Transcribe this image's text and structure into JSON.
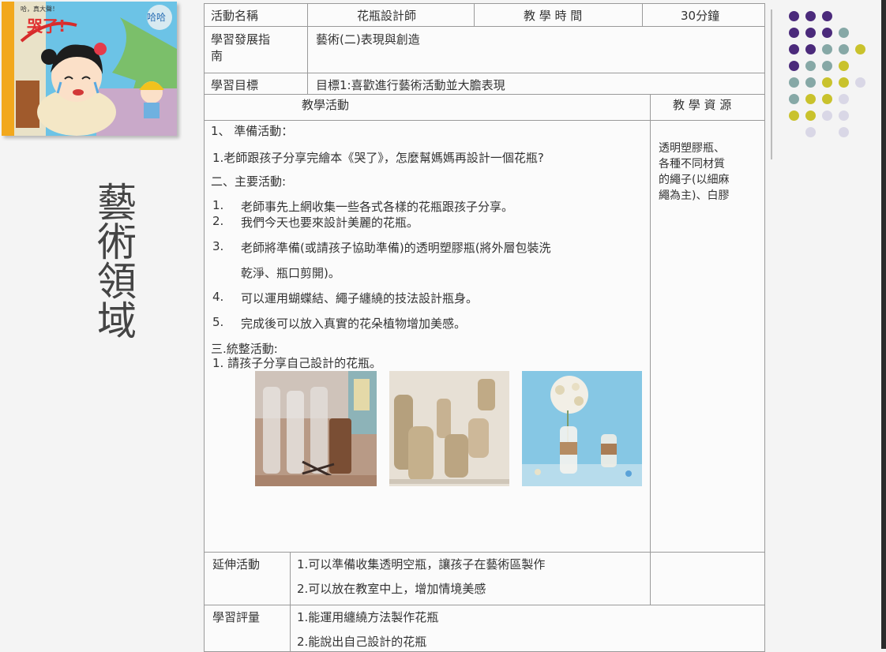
{
  "side_title": "藝術領域",
  "book": {
    "top_label": "哈，真大聲！",
    "title": "哭了!",
    "corner_mark": "哈哈"
  },
  "header": {
    "activity_name_label": "活動名稱",
    "activity_name_value": "花瓶設計師",
    "time_label": "教 學 時 間",
    "time_value": "30分鐘",
    "guide_label_line1": "學習發展指",
    "guide_label_line2": "南",
    "guide_value": "藝術(二)表現與創造",
    "goal_label": "學習目標",
    "goal_value": "目標1:喜歡進行藝術活動並大膽表現"
  },
  "activity": {
    "header": "教學活動",
    "resource_header": "教 學 資 源",
    "prep_title": "1、  準備活動：",
    "prep_item": "1.老師跟孩子分享完繪本《哭了》，怎麼幫媽媽再設計一個花瓶?",
    "main_title": "二、主要活動:",
    "main_items": [
      {
        "num": "1.",
        "text": "老師事先上網收集一些各式各樣的花瓶跟孩子分享。"
      },
      {
        "num": "2.",
        "text": "我們今天也要來設計美麗的花瓶。"
      },
      {
        "num": "3.",
        "text": "老師將準備(或請孩子協助準備)的透明塑膠瓶(將外層包裝洗"
      },
      {
        "num": "",
        "text": "乾淨、瓶口剪開)。"
      },
      {
        "num": "4.",
        "text": "可以運用蝴蝶結、繩子纏繞的技法設計瓶身。"
      },
      {
        "num": "5.",
        "text": "完成後可以放入真實的花朵植物增加美感。"
      }
    ],
    "wrap_title": "三.統整活動:",
    "wrap_item": "1. 請孩子分享自己設計的花瓶。",
    "resources": [
      "透明塑膠瓶、",
      "各種不同材質",
      "的繩子(以細麻",
      "繩為主)、白膠"
    ]
  },
  "extension": {
    "label": "延伸活動",
    "items": [
      "1.可以準備收集透明空瓶，讓孩子在藝術區製作",
      "2.可以放在教室中上，增加情境美感"
    ]
  },
  "assessment": {
    "label": "學習評量",
    "items": [
      "1.能運用纏繞方法製作花瓶",
      "2.能說出自己設計的花瓶"
    ]
  },
  "colors": {
    "purple": "#4b2a7b",
    "teal": "#86a8a6",
    "yellow": "#c9c22c",
    "lavender": "#d9d7e6"
  }
}
